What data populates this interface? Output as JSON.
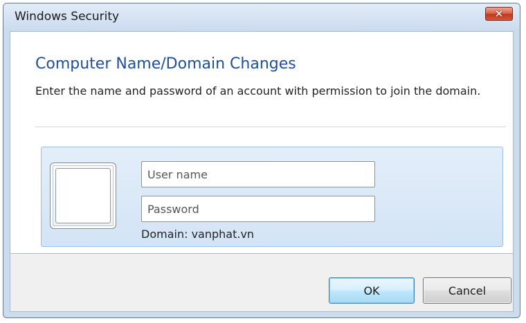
{
  "window": {
    "title": "Windows Security",
    "close_symbol": "✕"
  },
  "dialog": {
    "heading": "Computer Name/Domain Changes",
    "instruction": "Enter the name and password of an account with permission to join the domain."
  },
  "credentials": {
    "username": {
      "value": "",
      "placeholder": "User name"
    },
    "password": {
      "value": "",
      "placeholder": "Password"
    },
    "domain_label": "Domain: vanphat.vn",
    "tile_icon": "user-tile-icon"
  },
  "buttons": {
    "ok_label": "OK",
    "cancel_label": "Cancel"
  },
  "colors": {
    "heading": "#1e4f98",
    "frame": "#ccdcef",
    "close_button": "#c2391c",
    "ok_button_border": "#3c7fb1"
  }
}
